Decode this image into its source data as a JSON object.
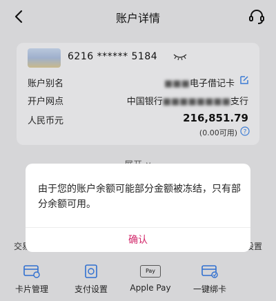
{
  "header": {
    "title": "账户详情",
    "back_icon": "chevron-left-icon",
    "service_icon": "headset-icon"
  },
  "card": {
    "card_number": "6216 ****** 5184",
    "alias_label": "账户别名",
    "alias_value_hidden": "■■■",
    "alias_value_visible": "电子借记卡",
    "branch_label": "开户网点",
    "branch_value_visible_start": "中国银行",
    "branch_value_hidden": "■■■■■■■■",
    "branch_value_visible_end": "支行",
    "currency_label": "人民币元",
    "balance": "216,851.79",
    "available": "(0.00可用)"
  },
  "behind": {
    "expand_label": "展开 ∨",
    "left_fragment": "交易",
    "right_fragment": "设置"
  },
  "dialog": {
    "message": "由于您的账户余额可能部分金额被冻结，只有部分余额可用。",
    "confirm_label": "确认"
  },
  "bottom": {
    "items": [
      {
        "label": "卡片管理",
        "icon": "card-manage-icon"
      },
      {
        "label": "支付设置",
        "icon": "payment-settings-icon"
      },
      {
        "label": "Apple Pay",
        "icon": "apple-pay-icon",
        "badge": "Pay"
      },
      {
        "label": "一键绑卡",
        "icon": "bind-card-icon"
      }
    ]
  },
  "colors": {
    "accent": "#d2276a",
    "link": "#3a7bd5"
  }
}
